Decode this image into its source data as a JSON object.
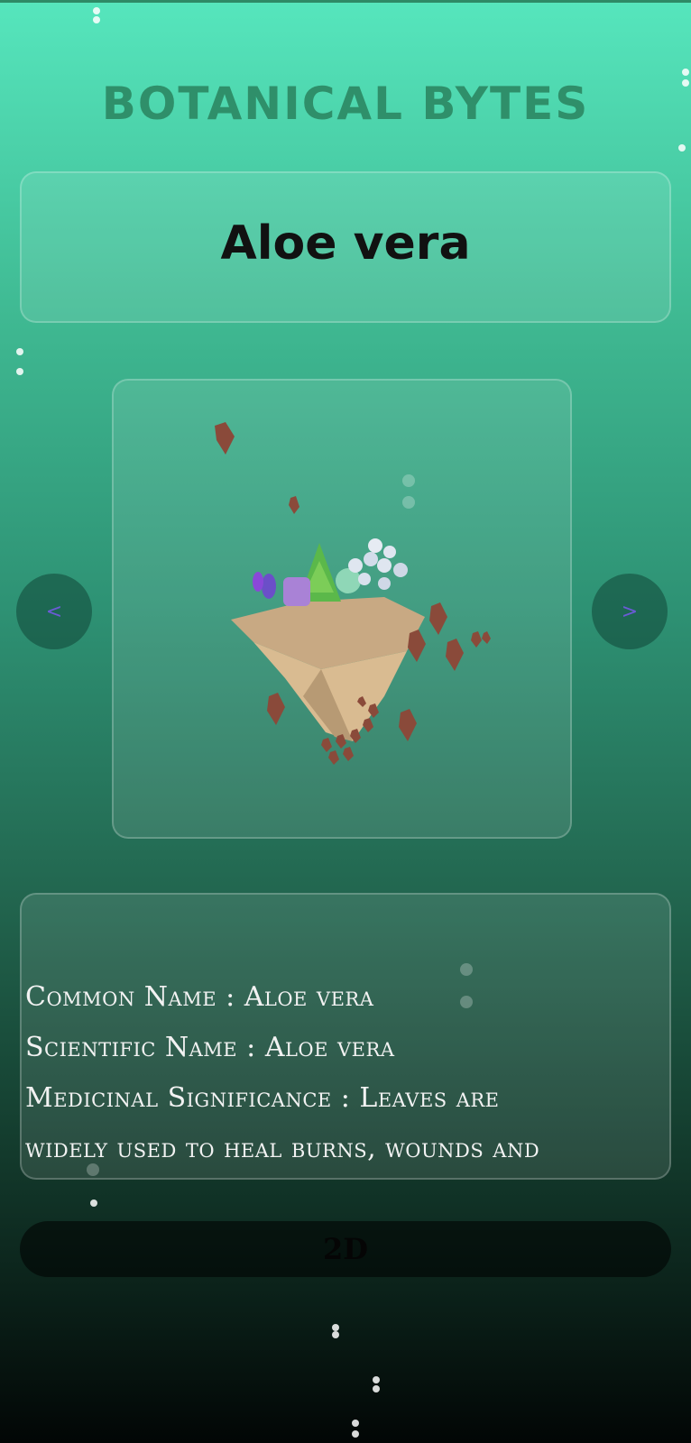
{
  "app": {
    "title": "BOTANICAL BYTES"
  },
  "plant": {
    "name": "Aloe vera"
  },
  "model_nav": {
    "prev_label": "<",
    "next_label": ">"
  },
  "info": {
    "common_name_line": "Common Name :  Aloe vera",
    "scientific_name_line": "Scientific Name : Aloe vera",
    "medicinal_line": "Medicinal Significance : Leaves are",
    "medicinal_line_2": "widely used to heal burns, wounds and"
  },
  "view_toggle": {
    "label": "2D"
  },
  "colors": {
    "accent_title": "#2f8f6a",
    "nav_arrow": "#6b5bd6",
    "bg_top": "#56e6bd",
    "bg_bottom": "#020605"
  }
}
